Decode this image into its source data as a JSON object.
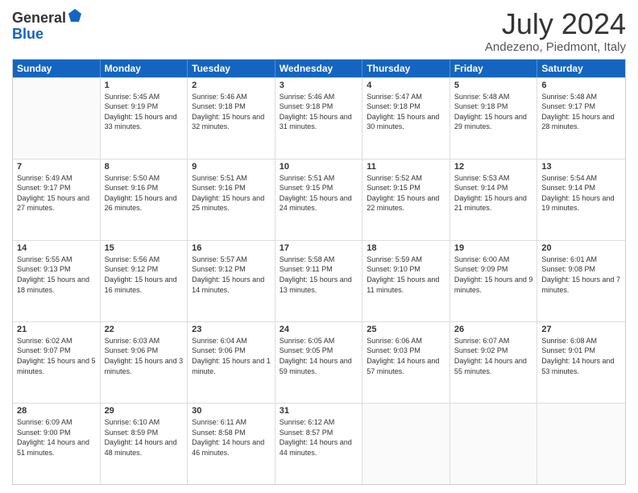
{
  "logo": {
    "general": "General",
    "blue": "Blue"
  },
  "title": "July 2024",
  "location": "Andezeno, Piedmont, Italy",
  "days_of_week": [
    "Sunday",
    "Monday",
    "Tuesday",
    "Wednesday",
    "Thursday",
    "Friday",
    "Saturday"
  ],
  "weeks": [
    [
      {
        "day": "",
        "sunrise": "",
        "sunset": "",
        "daylight": ""
      },
      {
        "day": "1",
        "sunrise": "Sunrise: 5:45 AM",
        "sunset": "Sunset: 9:19 PM",
        "daylight": "Daylight: 15 hours and 33 minutes."
      },
      {
        "day": "2",
        "sunrise": "Sunrise: 5:46 AM",
        "sunset": "Sunset: 9:18 PM",
        "daylight": "Daylight: 15 hours and 32 minutes."
      },
      {
        "day": "3",
        "sunrise": "Sunrise: 5:46 AM",
        "sunset": "Sunset: 9:18 PM",
        "daylight": "Daylight: 15 hours and 31 minutes."
      },
      {
        "day": "4",
        "sunrise": "Sunrise: 5:47 AM",
        "sunset": "Sunset: 9:18 PM",
        "daylight": "Daylight: 15 hours and 30 minutes."
      },
      {
        "day": "5",
        "sunrise": "Sunrise: 5:48 AM",
        "sunset": "Sunset: 9:18 PM",
        "daylight": "Daylight: 15 hours and 29 minutes."
      },
      {
        "day": "6",
        "sunrise": "Sunrise: 5:48 AM",
        "sunset": "Sunset: 9:17 PM",
        "daylight": "Daylight: 15 hours and 28 minutes."
      }
    ],
    [
      {
        "day": "7",
        "sunrise": "Sunrise: 5:49 AM",
        "sunset": "Sunset: 9:17 PM",
        "daylight": "Daylight: 15 hours and 27 minutes."
      },
      {
        "day": "8",
        "sunrise": "Sunrise: 5:50 AM",
        "sunset": "Sunset: 9:16 PM",
        "daylight": "Daylight: 15 hours and 26 minutes."
      },
      {
        "day": "9",
        "sunrise": "Sunrise: 5:51 AM",
        "sunset": "Sunset: 9:16 PM",
        "daylight": "Daylight: 15 hours and 25 minutes."
      },
      {
        "day": "10",
        "sunrise": "Sunrise: 5:51 AM",
        "sunset": "Sunset: 9:15 PM",
        "daylight": "Daylight: 15 hours and 24 minutes."
      },
      {
        "day": "11",
        "sunrise": "Sunrise: 5:52 AM",
        "sunset": "Sunset: 9:15 PM",
        "daylight": "Daylight: 15 hours and 22 minutes."
      },
      {
        "day": "12",
        "sunrise": "Sunrise: 5:53 AM",
        "sunset": "Sunset: 9:14 PM",
        "daylight": "Daylight: 15 hours and 21 minutes."
      },
      {
        "day": "13",
        "sunrise": "Sunrise: 5:54 AM",
        "sunset": "Sunset: 9:14 PM",
        "daylight": "Daylight: 15 hours and 19 minutes."
      }
    ],
    [
      {
        "day": "14",
        "sunrise": "Sunrise: 5:55 AM",
        "sunset": "Sunset: 9:13 PM",
        "daylight": "Daylight: 15 hours and 18 minutes."
      },
      {
        "day": "15",
        "sunrise": "Sunrise: 5:56 AM",
        "sunset": "Sunset: 9:12 PM",
        "daylight": "Daylight: 15 hours and 16 minutes."
      },
      {
        "day": "16",
        "sunrise": "Sunrise: 5:57 AM",
        "sunset": "Sunset: 9:12 PM",
        "daylight": "Daylight: 15 hours and 14 minutes."
      },
      {
        "day": "17",
        "sunrise": "Sunrise: 5:58 AM",
        "sunset": "Sunset: 9:11 PM",
        "daylight": "Daylight: 15 hours and 13 minutes."
      },
      {
        "day": "18",
        "sunrise": "Sunrise: 5:59 AM",
        "sunset": "Sunset: 9:10 PM",
        "daylight": "Daylight: 15 hours and 11 minutes."
      },
      {
        "day": "19",
        "sunrise": "Sunrise: 6:00 AM",
        "sunset": "Sunset: 9:09 PM",
        "daylight": "Daylight: 15 hours and 9 minutes."
      },
      {
        "day": "20",
        "sunrise": "Sunrise: 6:01 AM",
        "sunset": "Sunset: 9:08 PM",
        "daylight": "Daylight: 15 hours and 7 minutes."
      }
    ],
    [
      {
        "day": "21",
        "sunrise": "Sunrise: 6:02 AM",
        "sunset": "Sunset: 9:07 PM",
        "daylight": "Daylight: 15 hours and 5 minutes."
      },
      {
        "day": "22",
        "sunrise": "Sunrise: 6:03 AM",
        "sunset": "Sunset: 9:06 PM",
        "daylight": "Daylight: 15 hours and 3 minutes."
      },
      {
        "day": "23",
        "sunrise": "Sunrise: 6:04 AM",
        "sunset": "Sunset: 9:06 PM",
        "daylight": "Daylight: 15 hours and 1 minute."
      },
      {
        "day": "24",
        "sunrise": "Sunrise: 6:05 AM",
        "sunset": "Sunset: 9:05 PM",
        "daylight": "Daylight: 14 hours and 59 minutes."
      },
      {
        "day": "25",
        "sunrise": "Sunrise: 6:06 AM",
        "sunset": "Sunset: 9:03 PM",
        "daylight": "Daylight: 14 hours and 57 minutes."
      },
      {
        "day": "26",
        "sunrise": "Sunrise: 6:07 AM",
        "sunset": "Sunset: 9:02 PM",
        "daylight": "Daylight: 14 hours and 55 minutes."
      },
      {
        "day": "27",
        "sunrise": "Sunrise: 6:08 AM",
        "sunset": "Sunset: 9:01 PM",
        "daylight": "Daylight: 14 hours and 53 minutes."
      }
    ],
    [
      {
        "day": "28",
        "sunrise": "Sunrise: 6:09 AM",
        "sunset": "Sunset: 9:00 PM",
        "daylight": "Daylight: 14 hours and 51 minutes."
      },
      {
        "day": "29",
        "sunrise": "Sunrise: 6:10 AM",
        "sunset": "Sunset: 8:59 PM",
        "daylight": "Daylight: 14 hours and 48 minutes."
      },
      {
        "day": "30",
        "sunrise": "Sunrise: 6:11 AM",
        "sunset": "Sunset: 8:58 PM",
        "daylight": "Daylight: 14 hours and 46 minutes."
      },
      {
        "day": "31",
        "sunrise": "Sunrise: 6:12 AM",
        "sunset": "Sunset: 8:57 PM",
        "daylight": "Daylight: 14 hours and 44 minutes."
      },
      {
        "day": "",
        "sunrise": "",
        "sunset": "",
        "daylight": ""
      },
      {
        "day": "",
        "sunrise": "",
        "sunset": "",
        "daylight": ""
      },
      {
        "day": "",
        "sunrise": "",
        "sunset": "",
        "daylight": ""
      }
    ]
  ]
}
